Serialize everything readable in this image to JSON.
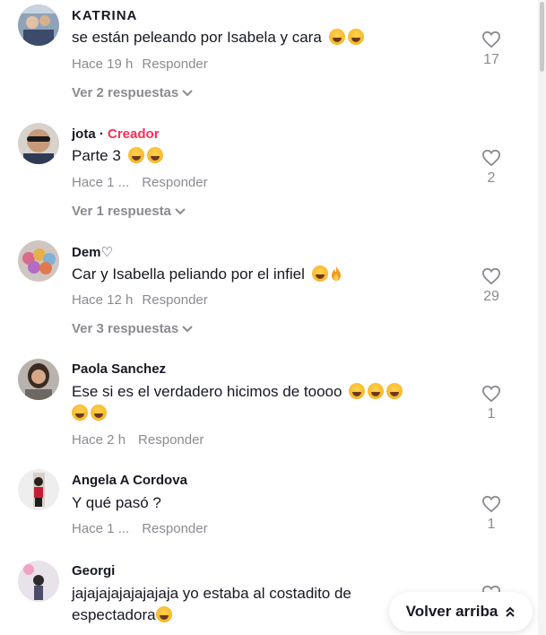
{
  "comments": [
    {
      "user": "KATRINA",
      "is_creator": false,
      "creator_label": "",
      "text": "se están peleando por Isabela y cara",
      "emojis": [
        "laughing-face",
        "laughing-face"
      ],
      "time": "Hace 19 h",
      "reply_label": "Responder",
      "likes": "17",
      "replies_label": "Ver 2 respuestas"
    },
    {
      "user": "jota",
      "is_creator": true,
      "creator_label": "Creador",
      "separator": "·",
      "text": "Parte 3",
      "emojis": [
        "rolling-laughing-face",
        "rolling-laughing-face"
      ],
      "time": "Hace 1 ...",
      "reply_label": "Responder",
      "likes": "2",
      "replies_label": "Ver 1 respuesta"
    },
    {
      "user": "Dem♡",
      "is_creator": false,
      "creator_label": "",
      "text": "Car y Isabella peliando por el infiel",
      "emojis": [
        "rolling-laughing-face",
        "fire"
      ],
      "time": "Hace 12 h",
      "reply_label": "Responder",
      "likes": "29",
      "replies_label": "Ver 3 respuestas"
    },
    {
      "user": "Paola Sanchez",
      "is_creator": false,
      "creator_label": "",
      "text": "Ese si es el verdadero hicimos de toooo",
      "emojis": [
        "rolling-laughing-face",
        "rolling-laughing-face",
        "rolling-laughing-face",
        "rolling-laughing-face",
        "rolling-laughing-face"
      ],
      "time": "Hace 2 h",
      "reply_label": "Responder",
      "likes": "1",
      "replies_label": ""
    },
    {
      "user": "Angela A Cordova",
      "is_creator": false,
      "creator_label": "",
      "text": "Y qué pasó ?",
      "emojis": [],
      "time": "Hace 1 ...",
      "reply_label": "Responder",
      "likes": "1",
      "replies_label": ""
    },
    {
      "user": "Georgi",
      "is_creator": false,
      "creator_label": "",
      "text": "jajajajajajajajaja yo estaba al costadito de espectadora",
      "emojis": [
        "laughing-face"
      ],
      "time": "",
      "reply_label": "",
      "likes": "",
      "replies_label": ""
    }
  ],
  "back_to_top": {
    "label": "Volver arriba",
    "icon": "double-chevron-up-icon"
  },
  "colors": {
    "username": "#161823",
    "meta": "#8a8b91",
    "creator": "#fe2c55"
  }
}
